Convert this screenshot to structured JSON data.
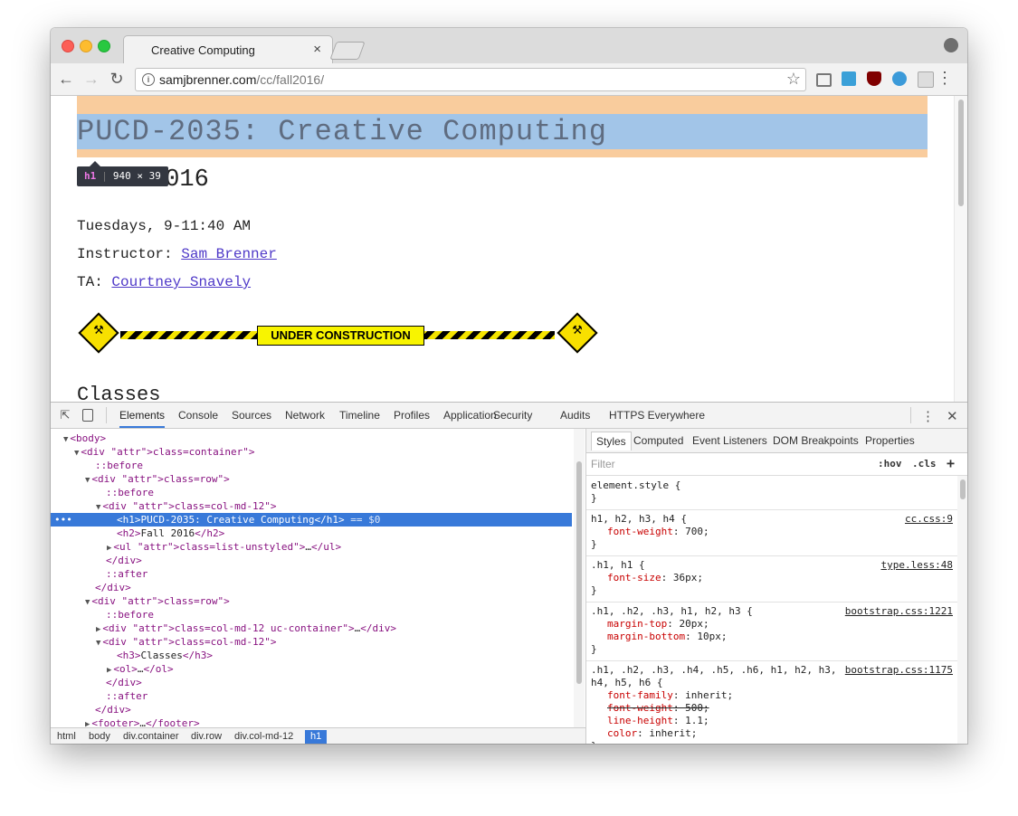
{
  "tab": {
    "title": "Creative Computing",
    "close": "×"
  },
  "address": {
    "domain": "samjbrenner.com",
    "path": "/cc/fall2016/"
  },
  "page": {
    "h1": "PUCD-2035: Creative Computing",
    "tooltip_tag": "h1",
    "tooltip_size": "940 × 39",
    "h2": "Fall 2016",
    "schedule": "Tuesdays, 9-11:40 AM",
    "instructor_label": "Instructor:",
    "instructor_name": "Sam Brenner",
    "ta_label": "TA:",
    "ta_name": "Courtney Snavely",
    "construction": "UNDER CONSTRUCTION",
    "h3": "Classes"
  },
  "devtools": {
    "tabs": [
      "Elements",
      "Console",
      "Sources",
      "Network",
      "Timeline",
      "Profiles",
      "Application",
      "Security",
      "Audits",
      "HTTPS Everywhere"
    ],
    "tree": [
      {
        "indent": 0,
        "arrow": "▼",
        "html": "<body>"
      },
      {
        "indent": 1,
        "arrow": "▼",
        "html": "<div class=\"container\">"
      },
      {
        "indent": 2,
        "arrow": "",
        "html": "::before"
      },
      {
        "indent": 2,
        "arrow": "▼",
        "html": "<div class=\"row\">"
      },
      {
        "indent": 3,
        "arrow": "",
        "html": "::before"
      },
      {
        "indent": 3,
        "arrow": "▼",
        "html": "<div class=\"col-md-12\">"
      },
      {
        "indent": 4,
        "arrow": "",
        "html": "<h1>PUCD-2035: Creative Computing</h1> == $0"
      },
      {
        "indent": 4,
        "arrow": "",
        "html": "<h2>Fall 2016</h2>"
      },
      {
        "indent": 4,
        "arrow": "▶",
        "html": "<ul class=\"list-unstyled\">…</ul>"
      },
      {
        "indent": 3,
        "arrow": "",
        "html": "</div>"
      },
      {
        "indent": 3,
        "arrow": "",
        "html": "::after"
      },
      {
        "indent": 2,
        "arrow": "",
        "html": "</div>"
      },
      {
        "indent": 2,
        "arrow": "▼",
        "html": "<div class=\"row\">"
      },
      {
        "indent": 3,
        "arrow": "",
        "html": "::before"
      },
      {
        "indent": 3,
        "arrow": "▶",
        "html": "<div class=\"col-md-12 uc-container\">…</div>"
      },
      {
        "indent": 3,
        "arrow": "▼",
        "html": "<div class=\"col-md-12\">"
      },
      {
        "indent": 4,
        "arrow": "",
        "html": "<h3>Classes</h3>"
      },
      {
        "indent": 4,
        "arrow": "▶",
        "html": "<ol>…</ol>"
      },
      {
        "indent": 3,
        "arrow": "",
        "html": "</div>"
      },
      {
        "indent": 3,
        "arrow": "",
        "html": "::after"
      },
      {
        "indent": 2,
        "arrow": "",
        "html": "</div>"
      },
      {
        "indent": 2,
        "arrow": "▶",
        "html": "<footer>…</footer>"
      }
    ],
    "breadcrumbs": [
      "html",
      "body",
      "div.container",
      "div.row",
      "div.col-md-12",
      "h1"
    ],
    "styles_tabs": [
      "Styles",
      "Computed",
      "Event Listeners",
      "DOM Breakpoints",
      "Properties"
    ],
    "filter_placeholder": "Filter",
    "hov": ":hov",
    "cls": ".cls",
    "rules": [
      {
        "selector": "element.style {",
        "source": "",
        "props": []
      },
      {
        "selector": "h1, h2, h3, h4 {",
        "source": "cc.css:9",
        "props": [
          {
            "name": "font-weight",
            "value": "700;",
            "struck": false
          }
        ]
      },
      {
        "selector": ".h1, h1 {",
        "source": "type.less:48",
        "props": [
          {
            "name": "font-size",
            "value": "36px;",
            "struck": false
          }
        ]
      },
      {
        "selector": ".h1, .h2, .h3, h1, h2, h3 {",
        "source": "bootstrap.css:1221",
        "props": [
          {
            "name": "margin-top",
            "value": "20px;",
            "struck": false
          },
          {
            "name": "margin-bottom",
            "value": "10px;",
            "struck": false
          }
        ]
      },
      {
        "selector": ".h1, .h2, .h3, .h4, .h5, .h6, h1, h2, h3,",
        "selector2": "h4, h5, h6 {",
        "source": "bootstrap.css:1175",
        "props": [
          {
            "name": "font-family",
            "value": "inherit;",
            "struck": false
          },
          {
            "name": "font-weight",
            "value": "500;",
            "struck": true
          },
          {
            "name": "line-height",
            "value": "1.1;",
            "struck": false
          },
          {
            "name": "color",
            "value": "inherit;",
            "struck": false
          }
        ]
      }
    ]
  }
}
